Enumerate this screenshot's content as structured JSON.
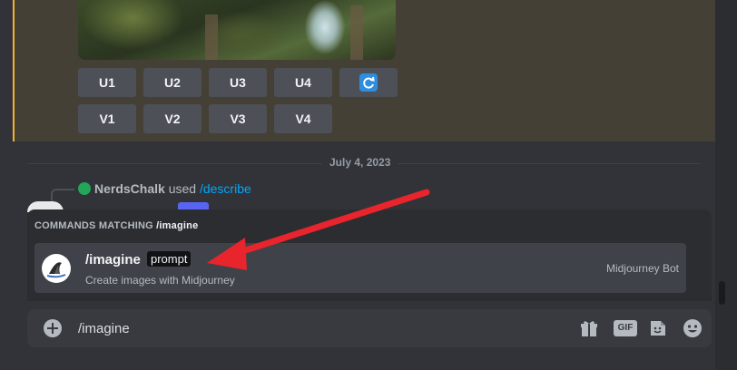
{
  "upscale_buttons": [
    "U1",
    "U2",
    "U3",
    "U4"
  ],
  "variation_buttons": [
    "V1",
    "V2",
    "V3",
    "V4"
  ],
  "reroll_icon": "refresh-icon",
  "date_divider": "July 4, 2023",
  "reply": {
    "username": "NerdsChalk",
    "used_text": "used",
    "command": "/describe"
  },
  "autocomplete": {
    "header_prefix": "COMMANDS MATCHING",
    "header_query": "/imagine",
    "command": "/imagine",
    "param": "prompt",
    "description": "Create images with Midjourney",
    "source": "Midjourney Bot"
  },
  "composer": {
    "value": "/imagine"
  },
  "icons": [
    "plus-icon",
    "gift-icon",
    "gif-icon",
    "sticker-icon",
    "emoji-icon"
  ],
  "gif_label": "GIF",
  "colors": {
    "accent_bar": "#f0b232",
    "arrow": "#e8242c",
    "link": "#00a8fc"
  }
}
